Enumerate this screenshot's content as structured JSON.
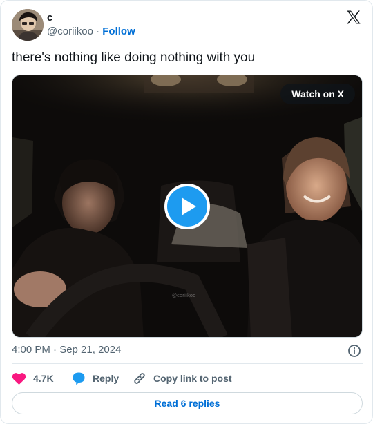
{
  "author": {
    "display_name": "c",
    "handle": "@coriikoo",
    "separator": "·",
    "follow_label": "Follow"
  },
  "tweet": {
    "text": "there's nothing like doing nothing with you"
  },
  "media": {
    "watch_label": "Watch on X",
    "watermark": "@coriikoo"
  },
  "meta": {
    "timestamp": "4:00 PM · Sep 21, 2024"
  },
  "actions": {
    "like_count": "4.7K",
    "reply_label": "Reply",
    "copy_label": "Copy link to post"
  },
  "footer": {
    "read_replies_label": "Read 6 replies"
  },
  "colors": {
    "accent": "#006fd6",
    "play": "#1d9bf0",
    "like": "#f91880",
    "muted": "#536471"
  }
}
